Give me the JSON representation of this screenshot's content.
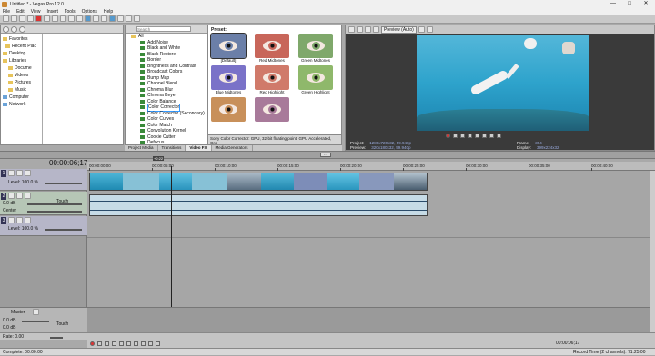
{
  "title": "Untitled * - Vegas Pro 12.0",
  "window_controls": [
    "—",
    "□",
    "✕"
  ],
  "menu": [
    "File",
    "Edit",
    "View",
    "Insert",
    "Tools",
    "Options",
    "Help"
  ],
  "explorer": {
    "tree": [
      {
        "label": "Favorites",
        "icon": "folder-icon"
      },
      {
        "label": "Recent Plac",
        "icon": "folder-icon"
      },
      {
        "label": "Desktop",
        "icon": "folder-icon"
      },
      {
        "label": "Libraries",
        "icon": "folder-icon"
      },
      {
        "label": "Docume",
        "icon": "folder-icon"
      },
      {
        "label": "Videos",
        "icon": "folder-icon"
      },
      {
        "label": "Pictures",
        "icon": "folder-icon"
      },
      {
        "label": "Music",
        "icon": "folder-icon"
      },
      {
        "label": "Computer",
        "icon": "computer-icon"
      },
      {
        "label": "Network",
        "icon": "network-icon"
      }
    ]
  },
  "fx": {
    "search_placeholder": "Search",
    "root": "All",
    "items": [
      "Add Noise",
      "Black and White",
      "Black Restore",
      "Border",
      "Brightness and Contrast",
      "Broadcast Colors",
      "Bump Map",
      "Channel Blend",
      "Chroma Blur",
      "Chroma Keyer",
      "Color Balance",
      "Color Corrector",
      "Color Corrector (Secondary)",
      "Color Curves",
      "Color Match",
      "Convolution Kernel",
      "Cookie Cutter",
      "Defocus"
    ],
    "selected": "Color Corrector"
  },
  "presets": {
    "label": "Preset:",
    "items": [
      {
        "name": "[Default]",
        "color": "#6b7fa8",
        "selected": true
      },
      {
        "name": "Red Midtones",
        "color": "#c8665a",
        "selected": false
      },
      {
        "name": "Green Midtones",
        "color": "#7fa86b",
        "selected": false
      },
      {
        "name": "Blue Midtones",
        "color": "#7a72c8",
        "selected": false
      },
      {
        "name": "Red Highlight",
        "color": "#d07a6a",
        "selected": false
      },
      {
        "name": "Green Highlight",
        "color": "#8fb86b",
        "selected": false
      },
      {
        "name": "",
        "color": "#c8905a",
        "selected": false
      },
      {
        "name": "",
        "color": "#a87a9a",
        "selected": false
      }
    ],
    "description_line1": "Sony Color Corrector: GPU, 32-bit floating point, GPU Accelerated, Gro",
    "description_line2": "Description: From Sony Creative Software Inc."
  },
  "tabs": [
    "Project Media",
    "Transitions",
    "Video FX",
    "Media Generators"
  ],
  "active_tab": "Video FX",
  "preview": {
    "dropdown": "Preview (Auto)",
    "project_label": "Project:",
    "project_value": "1280x720x32, 59.940p",
    "preview_label": "Preview:",
    "preview_value": "320x180x32, 59.940p",
    "frame_label": "Frame:",
    "frame_value": "394",
    "display_label": "Display:",
    "display_value": "399x224x32"
  },
  "timeline": {
    "timecode": "00:00:06;17",
    "marker": "+2:22",
    "ruler": [
      "00:00:00;00",
      "00:00:05;00",
      "00:00:10;00",
      "00:00:15;00",
      "00:00:20;00",
      "00:00:25;00",
      "00:00:30;00",
      "00:00:35;00",
      "00:00:40;00",
      "00:00:45;00"
    ],
    "ruler_short": [
      "00:00:00:00",
      "00:00:05:00",
      "00:00:10:00",
      "00:00:15:00",
      "00:00:20:00",
      "00:00:25:00",
      "00:00:30:00",
      "00:00:35:00",
      "00:00:40:00"
    ],
    "tracks": [
      {
        "num": "1",
        "kind": "video",
        "level_label": "Level: 100.0 %"
      },
      {
        "num": "2",
        "kind": "audio",
        "vol": "0.0 dB",
        "pan": "Center",
        "mode": "Touch"
      },
      {
        "num": "3",
        "kind": "video",
        "level_label": "Level: 100.0 %"
      }
    ]
  },
  "master": {
    "label": "Master",
    "vol1": "0.0 dB",
    "vol2": "0.0 dB",
    "mode": "Touch"
  },
  "rate": "Rate: 0.00",
  "transport_time": "00:00:06;17",
  "status_left": "Complete: 00:00:00",
  "status_right": "Record Time (2 channels): 71:25:00"
}
